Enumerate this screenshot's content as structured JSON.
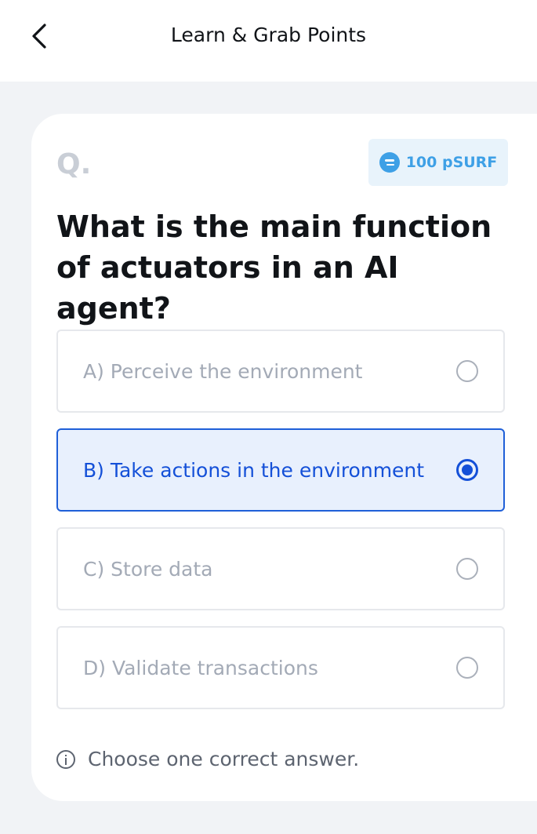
{
  "header": {
    "title": "Learn & Grab Points"
  },
  "quiz": {
    "q_label": "Q.",
    "reward": "100 pSURF",
    "question": "What is the main function of actuators in an AI agent?",
    "options": [
      {
        "label": "A) Perceive the environment",
        "selected": false
      },
      {
        "label": "B) Take actions in the environment",
        "selected": true
      },
      {
        "label": "C) Store data",
        "selected": false
      },
      {
        "label": "D) Validate transactions",
        "selected": false
      }
    ],
    "hint": "Choose one correct answer."
  },
  "colors": {
    "accent": "#1450d8",
    "badge": "#3ea0e6",
    "background": "#f1f3f6"
  },
  "icons": [
    "back-arrow-icon",
    "coin-icon",
    "radio-icon",
    "info-icon"
  ]
}
